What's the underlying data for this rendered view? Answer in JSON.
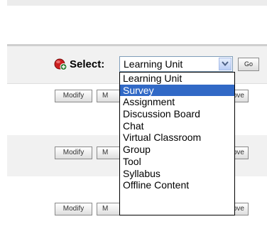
{
  "toolbar": {
    "select_label": "Select:",
    "selected_value": "Learning Unit",
    "go_label": "Go"
  },
  "dropdown": {
    "highlighted_index": 1,
    "options": [
      "Learning Unit",
      "Survey",
      "Assignment",
      "Discussion Board",
      "Chat",
      "Virtual Classroom",
      "Group",
      "Tool",
      "Syllabus",
      "Offline Content"
    ]
  },
  "rows": [
    {
      "modify_label": "Modify",
      "m_label": "M",
      "move_label": "ove"
    },
    {
      "modify_label": "Modify",
      "m_label": "M",
      "move_label": "ove"
    },
    {
      "modify_label": "Modify",
      "m_label": "M",
      "move_label": "ove"
    }
  ],
  "colors": {
    "highlight": "#3169c6",
    "icon_red": "#cc1f1f",
    "band": "#f1f1f1"
  }
}
